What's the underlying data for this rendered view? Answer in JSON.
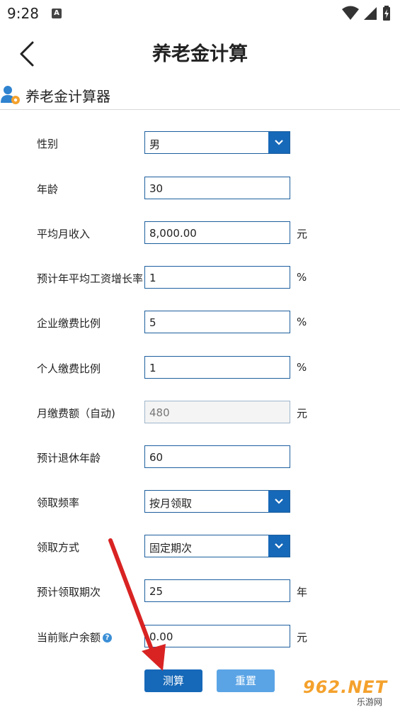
{
  "status_bar": {
    "time": "9:28",
    "notification_icon": "A"
  },
  "header": {
    "title": "养老金计算"
  },
  "section": {
    "title": "养老金计算器"
  },
  "form": {
    "gender": {
      "label": "性别",
      "value": "男"
    },
    "age": {
      "label": "年龄",
      "value": "30"
    },
    "avg_monthly_income": {
      "label": "平均月收入",
      "value": "8,000.00",
      "unit": "元"
    },
    "wage_growth_rate": {
      "label": "预计年平均工资增长率",
      "value": "1",
      "unit": "%"
    },
    "company_contribution": {
      "label": "企业缴费比例",
      "value": "5",
      "unit": "%"
    },
    "personal_contribution": {
      "label": "个人缴费比例",
      "value": "1",
      "unit": "%"
    },
    "monthly_payment": {
      "label": "月缴费额（自动)",
      "value": "480",
      "unit": "元"
    },
    "retirement_age": {
      "label": "预计退休年龄",
      "value": "60"
    },
    "frequency": {
      "label": "领取频率",
      "value": "按月领取"
    },
    "method": {
      "label": "领取方式",
      "value": "固定期次"
    },
    "periods": {
      "label": "预计领取期次",
      "value": "25",
      "unit": "年"
    },
    "current_balance": {
      "label": "当前账户余额",
      "value": "0.00",
      "unit": "元",
      "help": "?"
    }
  },
  "buttons": {
    "calculate": "测算",
    "reset": "重置"
  },
  "watermark": {
    "main": "962.NET",
    "sub": "乐游网"
  },
  "colors": {
    "primary": "#1668b8",
    "secondary": "#5aa4e6",
    "field_border": "#1d5f9e",
    "annotation_arrow": "#d92323"
  }
}
